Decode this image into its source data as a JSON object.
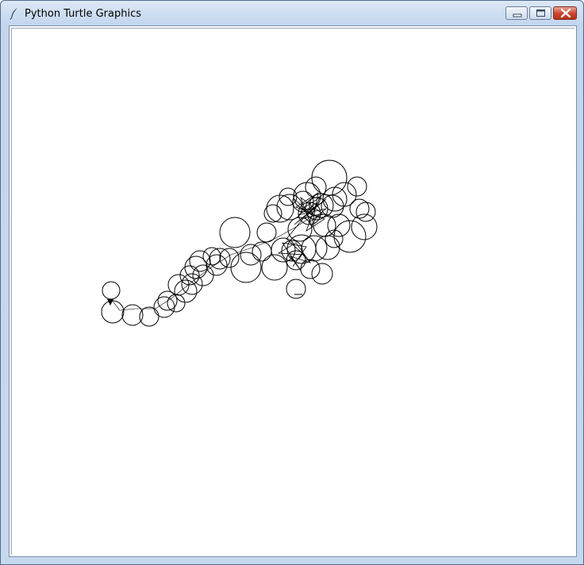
{
  "window": {
    "title": "Python Turtle Graphics",
    "controls": [
      "minimize",
      "maximize",
      "close"
    ],
    "icon": "feather-icon"
  },
  "canvas": {
    "background": "#ffffff",
    "stroke_color": "#000000",
    "content": "random-walk-circles",
    "turtle_heading": "down"
  }
}
